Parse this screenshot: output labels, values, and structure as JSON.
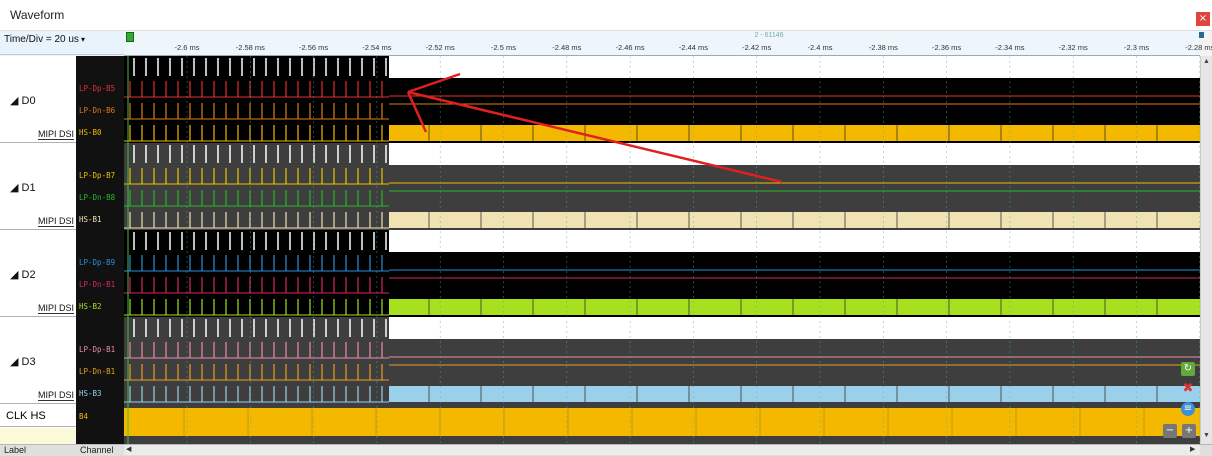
{
  "window": {
    "title": "Waveform",
    "close_glyph": "×"
  },
  "time_div": "Time/Div = 20 us",
  "ruler": {
    "cursor_label": "2 - 61146",
    "ticks": [
      "-2.6 ms",
      "-2.58 ms",
      "-2.56 ms",
      "-2.54 ms",
      "-2.52 ms",
      "-2.5 ms",
      "-2.48 ms",
      "-2.46 ms",
      "-2.44 ms",
      "-2.42 ms",
      "-2.4 ms",
      "-2.38 ms",
      "-2.36 ms",
      "-2.34 ms",
      "-2.32 ms",
      "-2.3 ms",
      "-2.28 ms"
    ]
  },
  "groups": [
    {
      "name": "◢ D0",
      "protocol": "MIPI DSI",
      "channels": [
        {
          "name": "LP-Dp-B5",
          "color": "#e23030"
        },
        {
          "name": "LP-Dn-B6",
          "color": "#e07a1a"
        },
        {
          "name": "HS-B0",
          "color": "#f5b800"
        }
      ]
    },
    {
      "name": "◢ D1",
      "protocol": "MIPI DSI",
      "channels": [
        {
          "name": "LP-Dp-B7",
          "color": "#e8c400"
        },
        {
          "name": "LP-Dn-B8",
          "color": "#26b826"
        },
        {
          "name": "HS-B1",
          "color": "#f1e2b4"
        }
      ]
    },
    {
      "name": "◢ D2",
      "protocol": "MIPI DSI",
      "channels": [
        {
          "name": "LP-Dp-B9",
          "color": "#2a8fd8"
        },
        {
          "name": "LP-Dn-B1",
          "color": "#d8285a"
        },
        {
          "name": "HS-B2",
          "color": "#a8e020"
        }
      ]
    },
    {
      "name": "◢ D3",
      "protocol": "MIPI DSI",
      "channels": [
        {
          "name": "LP-Dp-B1",
          "color": "#ef8aa8"
        },
        {
          "name": "LP-Dn-B1",
          "color": "#e8a020"
        },
        {
          "name": "HS-B3",
          "color": "#9bd0ea"
        }
      ]
    }
  ],
  "clk": {
    "name": "CLK HS",
    "channel": "B4",
    "color": "#f5b800"
  },
  "footer": {
    "label_header": "Label",
    "channel_header": "Channel"
  },
  "annotation_color": "#e02020",
  "icons": {
    "refresh": "refresh-icon",
    "delete": "delete-icon",
    "note": "note-icon",
    "zoom_out": "zoom-out-icon",
    "zoom_in": "zoom-in-icon"
  }
}
